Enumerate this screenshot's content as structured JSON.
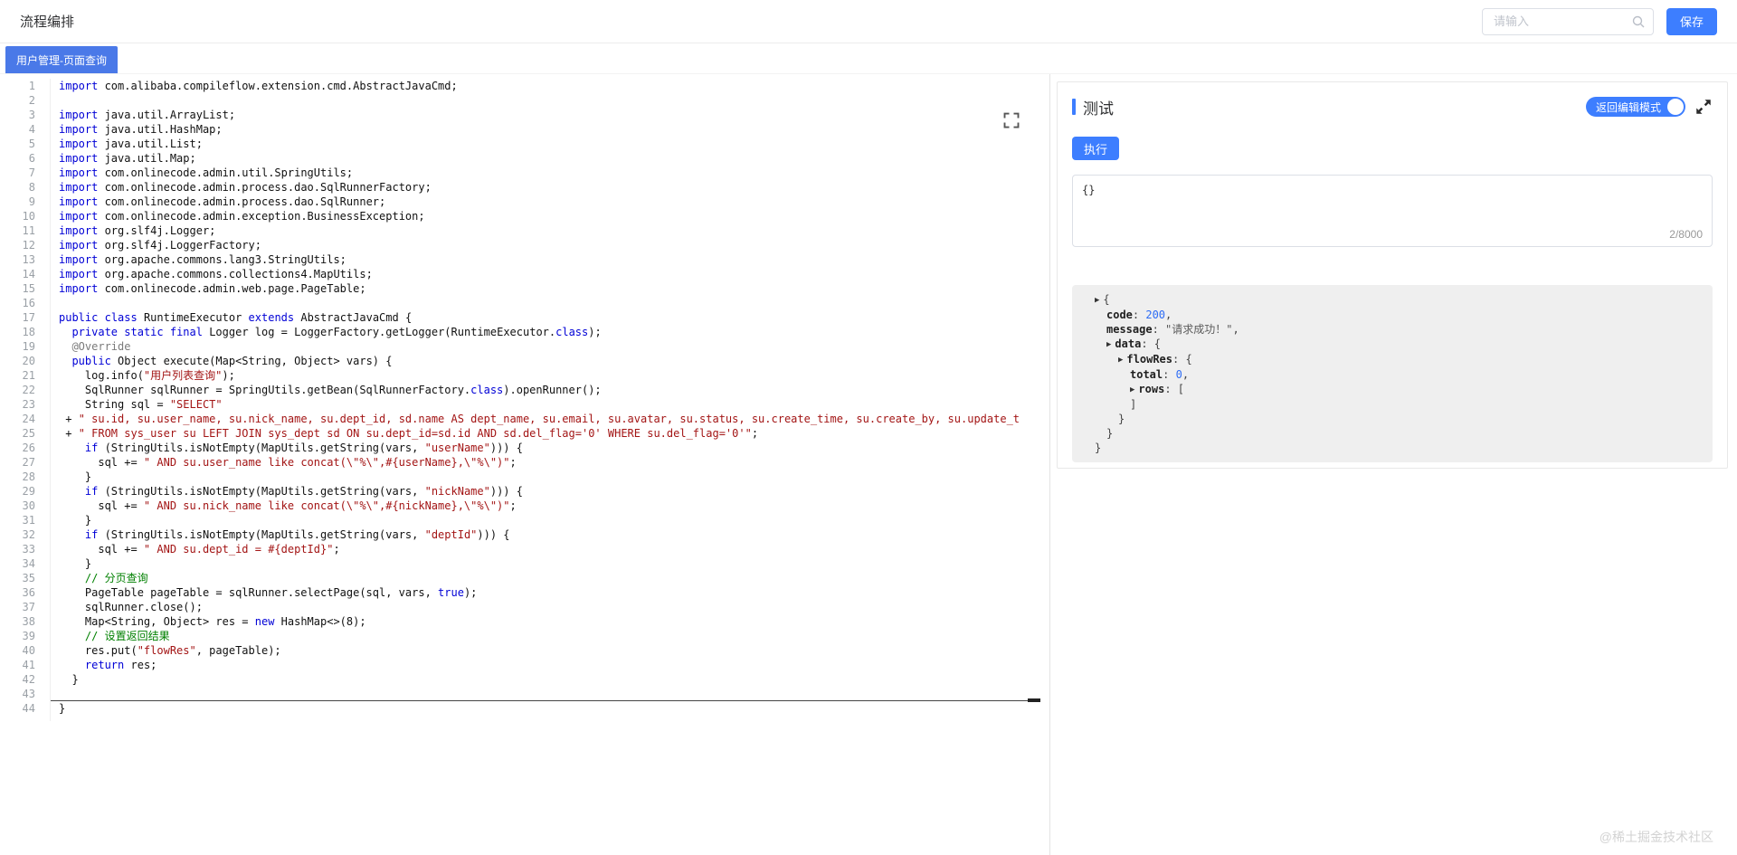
{
  "header": {
    "title": "流程编排",
    "search_placeholder": "请输入",
    "search_value": "",
    "save_label": "保存"
  },
  "tabs": [
    {
      "label": "用户管理-页面查询",
      "active": true
    }
  ],
  "icons": {
    "search": "search-icon (magnifier)",
    "editor_fullscreen": "fullscreen-corners-icon",
    "panel_expand": "expand-arrows-icon",
    "tree_arrow": "▸"
  },
  "colors": {
    "accent_blue": "#3d7eff",
    "tab_blue": "#4a79e8",
    "keyword": "#0000d6",
    "string": "#a31515",
    "comment": "#008000",
    "json_number": "#2d6cf5",
    "result_bg": "#efefef"
  },
  "editor": {
    "language": "java",
    "lines": [
      "import com.alibaba.compileflow.extension.cmd.AbstractJavaCmd;",
      "",
      "import java.util.ArrayList;",
      "import java.util.HashMap;",
      "import java.util.List;",
      "import java.util.Map;",
      "import com.onlinecode.admin.util.SpringUtils;",
      "import com.onlinecode.admin.process.dao.SqlRunnerFactory;",
      "import com.onlinecode.admin.process.dao.SqlRunner;",
      "import com.onlinecode.admin.exception.BusinessException;",
      "import org.slf4j.Logger;",
      "import org.slf4j.LoggerFactory;",
      "import org.apache.commons.lang3.StringUtils;",
      "import org.apache.commons.collections4.MapUtils;",
      "import com.onlinecode.admin.web.page.PageTable;",
      "",
      "public class RuntimeExecutor extends AbstractJavaCmd {",
      "  private static final Logger log = LoggerFactory.getLogger(RuntimeExecutor.class);",
      "  @Override",
      "  public Object execute(Map<String, Object> vars) {",
      "    log.info(\"用户列表查询\");",
      "    SqlRunner sqlRunner = SpringUtils.getBean(SqlRunnerFactory.class).openRunner();",
      "    String sql = \"SELECT\"",
      " + \" su.id, su.user_name, su.nick_name, su.dept_id, sd.name AS dept_name, su.email, su.avatar, su.status, su.create_time, su.create_by, su.update_t",
      " + \" FROM sys_user su LEFT JOIN sys_dept sd ON su.dept_id=sd.id AND sd.del_flag='0' WHERE su.del_flag='0'\";",
      "    if (StringUtils.isNotEmpty(MapUtils.getString(vars, \"userName\"))) {",
      "      sql += \" AND su.user_name like concat(\\\"%\\\",#{userName},\\\"%\\\")\";",
      "    }",
      "    if (StringUtils.isNotEmpty(MapUtils.getString(vars, \"nickName\"))) {",
      "      sql += \" AND su.nick_name like concat(\\\"%\\\",#{nickName},\\\"%\\\")\";",
      "    }",
      "    if (StringUtils.isNotEmpty(MapUtils.getString(vars, \"deptId\"))) {",
      "      sql += \" AND su.dept_id = #{deptId}\";",
      "    }",
      "    // 分页查询",
      "    PageTable pageTable = sqlRunner.selectPage(sql, vars, true);",
      "    sqlRunner.close();",
      "    Map<String, Object> res = new HashMap<>(8);",
      "    // 设置返回结果",
      "    res.put(\"flowRes\", pageTable);",
      "    return res;",
      "  }",
      "",
      "}"
    ]
  },
  "test_panel": {
    "title": "测试",
    "back_to_edit_label": "返回编辑模式",
    "run_label": "执行",
    "input_value": "{}",
    "char_counter": "2/8000",
    "result_tree": [
      {
        "indent": 1,
        "arrow": true,
        "seg": [
          {
            "t": "{",
            "c": "p"
          }
        ]
      },
      {
        "indent": 2,
        "seg": [
          {
            "t": "code",
            "c": "k"
          },
          {
            "t": ": ",
            "c": "p"
          },
          {
            "t": "200",
            "c": "n"
          },
          {
            "t": ",",
            "c": "p"
          }
        ]
      },
      {
        "indent": 2,
        "seg": [
          {
            "t": "message",
            "c": "k"
          },
          {
            "t": ": ",
            "c": "p"
          },
          {
            "t": "\"请求成功！\"",
            "c": "s"
          },
          {
            "t": ",",
            "c": "p"
          }
        ]
      },
      {
        "indent": 2,
        "arrow": true,
        "seg": [
          {
            "t": "data",
            "c": "k"
          },
          {
            "t": ": {",
            "c": "p"
          }
        ]
      },
      {
        "indent": 3,
        "arrow": true,
        "seg": [
          {
            "t": "flowRes",
            "c": "k"
          },
          {
            "t": ": {",
            "c": "p"
          }
        ]
      },
      {
        "indent": 4,
        "seg": [
          {
            "t": "total",
            "c": "k"
          },
          {
            "t": ": ",
            "c": "p"
          },
          {
            "t": "0",
            "c": "n"
          },
          {
            "t": ",",
            "c": "p"
          }
        ]
      },
      {
        "indent": 4,
        "arrow": true,
        "seg": [
          {
            "t": "rows",
            "c": "k"
          },
          {
            "t": ": [",
            "c": "p"
          }
        ]
      },
      {
        "indent": 4,
        "seg": [
          {
            "t": "]",
            "c": "p"
          }
        ]
      },
      {
        "indent": 3,
        "seg": [
          {
            "t": "}",
            "c": "p"
          }
        ]
      },
      {
        "indent": 2,
        "seg": [
          {
            "t": "}",
            "c": "p"
          }
        ]
      },
      {
        "indent": 1,
        "seg": [
          {
            "t": "}",
            "c": "p"
          }
        ]
      }
    ]
  },
  "watermark": "@稀土掘金技术社区"
}
